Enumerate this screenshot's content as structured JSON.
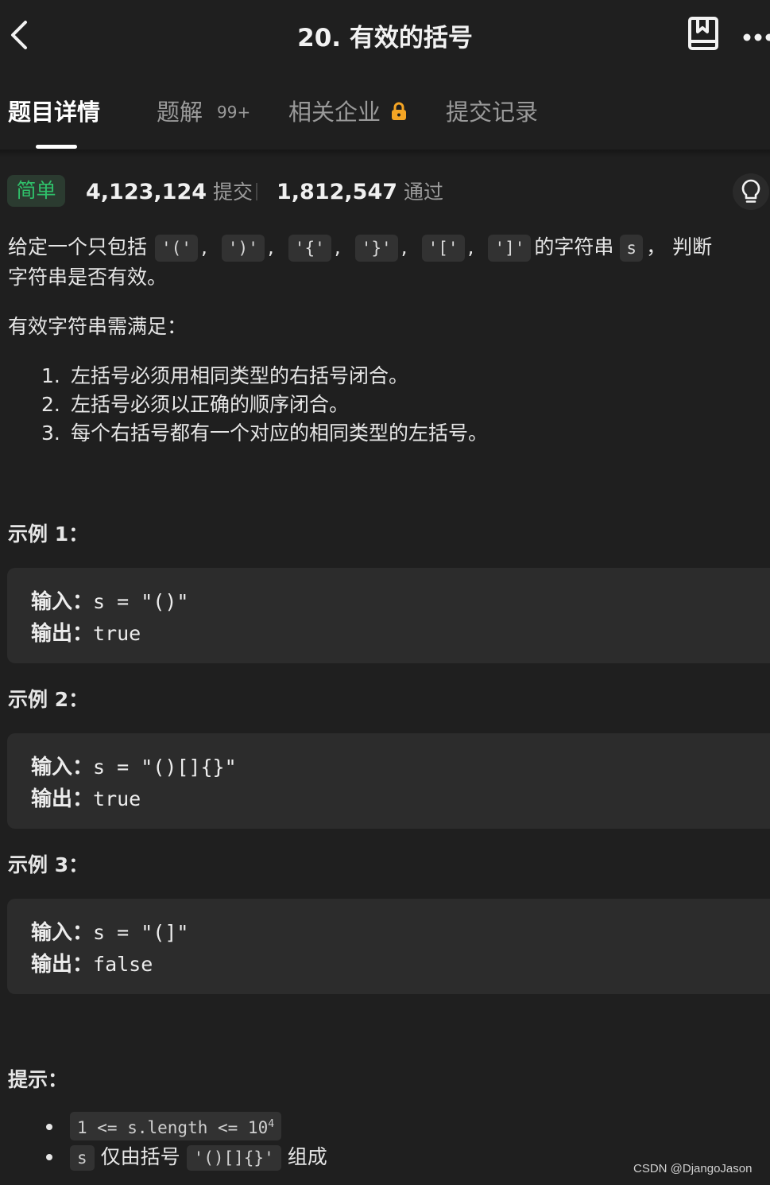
{
  "header": {
    "title": "20. 有效的括号"
  },
  "tabs": [
    {
      "label": "题目详情",
      "active": true
    },
    {
      "label": "题解",
      "badge": "99+"
    },
    {
      "label": "相关企业",
      "locked": true
    },
    {
      "label": "提交记录"
    }
  ],
  "stats": {
    "difficulty": "简单",
    "submissions": "4,123,124",
    "submissions_label": "提交",
    "accepted": "1,812,547",
    "accepted_label": "通过"
  },
  "description": {
    "intro_prefix": "给定一个只包括",
    "chars": [
      "'('",
      "')'",
      "'{'",
      "'}'",
      "'['",
      "']'"
    ],
    "intro_mid": "的字符串",
    "var": "s",
    "intro_suffix": "判断",
    "line2": "字符串是否有效。",
    "rules_title": "有效字符串需满足：",
    "rules": [
      "左括号必须用相同类型的右括号闭合。",
      "左括号必须以正确的顺序闭合。",
      "每个右括号都有一个对应的相同类型的左括号。"
    ]
  },
  "examples": [
    {
      "title": "示例 1：",
      "input_label": "输入：",
      "input": "s = \"()\"",
      "output_label": "输出：",
      "output": "true"
    },
    {
      "title": "示例 2：",
      "input_label": "输入：",
      "input": "s = \"()[]{}\"",
      "output_label": "输出：",
      "output": "true"
    },
    {
      "title": "示例 3：",
      "input_label": "输入：",
      "input": "s = \"(]\"",
      "output_label": "输出：",
      "output": "false"
    }
  ],
  "tips": {
    "title": "提示：",
    "constraint_1": "1 <= s.length <= 10",
    "constraint_1_exp": "4",
    "constraint_2_var": "s",
    "constraint_2_text": "仅由括号",
    "constraint_2_chars": "'()[]{}'",
    "constraint_2_suffix": "组成"
  },
  "watermark": "CSDN @DjangoJason",
  "colors": {
    "background": "#1f1f1f",
    "easy_green": "#2fc06a",
    "lock_orange": "#f5a524",
    "code_bg": "#2c2c2c"
  },
  "icons": [
    "back-icon",
    "book-icon",
    "more-icon",
    "lock-icon",
    "lightbulb-icon"
  ]
}
